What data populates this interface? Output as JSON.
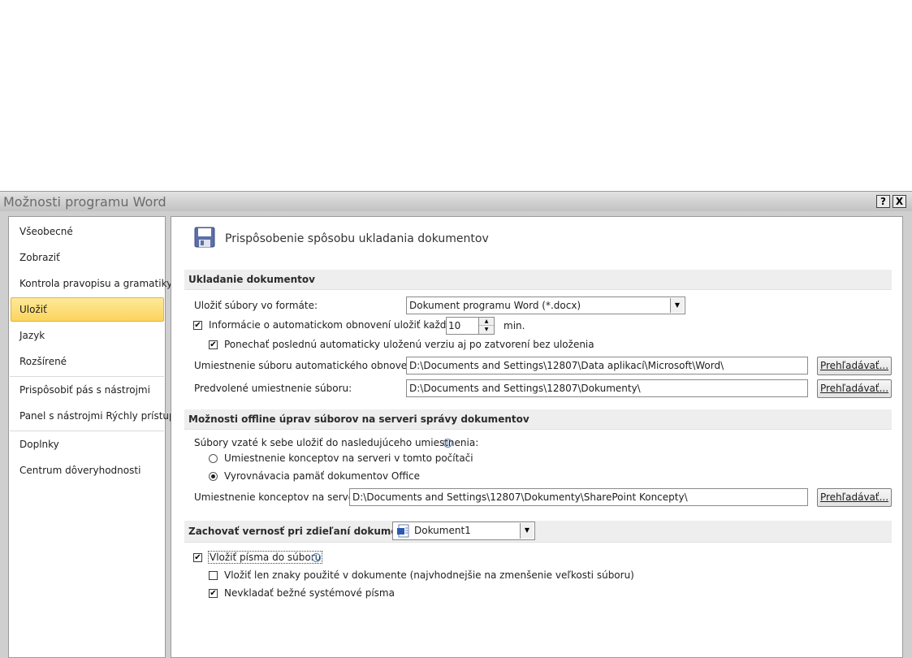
{
  "window": {
    "title": "Možnosti programu Word",
    "help_glyph": "?",
    "close_glyph": "X"
  },
  "sidebar": {
    "items": [
      {
        "label": "Všeobecné"
      },
      {
        "label": "Zobraziť"
      },
      {
        "label": "Kontrola pravopisu a gramatiky"
      },
      {
        "label": "Uložiť",
        "selected": true
      },
      {
        "label": "Jazyk"
      },
      {
        "label": "Rozšírené"
      },
      {
        "label": "Prispôsobiť pás s nástrojmi"
      },
      {
        "label": "Panel s nástrojmi Rýchly prístup"
      },
      {
        "label": "Doplnky"
      },
      {
        "label": "Centrum dôveryhodnosti"
      }
    ]
  },
  "main": {
    "heading": "Prispôsobenie spôsobu ukladania dokumentov",
    "heading_icon": "floppy-disk-icon",
    "save_section": {
      "title": "Ukladanie dokumentov",
      "format_label": "Uložiť súbory vo formáte:",
      "format_value": "Dokument programu Word (*.docx)",
      "autorecover_label": "Informácie o automatickom obnovení uložiť každých",
      "autorecover_checked": true,
      "autorecover_minutes": "10",
      "minutes_unit": "min.",
      "keep_last_label": "Ponechať poslednú automaticky uloženú verziu aj po zatvorení bez uloženia",
      "keep_last_checked": true,
      "autorecover_location_label": "Umiestnenie súboru automatického obnovenia:",
      "autorecover_location_value": "D:\\Documents and Settings\\12807\\Data aplikací\\Microsoft\\Word\\",
      "default_location_label": "Predvolené umiestnenie súboru:",
      "default_location_value": "D:\\Documents and Settings\\12807\\Dokumenty\\",
      "browse_label": "Prehľadávať..."
    },
    "offline_section": {
      "title": "Možnosti offline úprav súborov na serveri správy dokumentov",
      "checkout_label": "Súbory vzaté k sebe uložiť do nasledujúceho umiestnenia:",
      "radio_server_label": "Umiestnenie konceptov na serveri v tomto počítači",
      "radio_server_checked": false,
      "radio_cache_label": "Vyrovnávacia pamäť dokumentov Office",
      "radio_cache_checked": true,
      "drafts_location_label": "Umiestnenie konceptov na serveri:",
      "drafts_location_value": "D:\\Documents and Settings\\12807\\Dokumenty\\SharePoint Koncepty\\",
      "browse_label": "Prehľadávať..."
    },
    "fidelity_section": {
      "title": "Zachovať vernosť pri zdieľaní dokumentu:",
      "document_value": "Dokument1",
      "embed_fonts_label": "Vložiť písma do súboru",
      "embed_fonts_checked": true,
      "embed_used_label": "Vložiť len znaky použité v dokumente (najvhodnejšie na zmenšenie veľkosti súboru)",
      "embed_used_checked": false,
      "no_common_label": "Nevkladať bežné systémové písma",
      "no_common_checked": true
    }
  },
  "glyphs": {
    "check": "✔",
    "dropdown": "▼",
    "spin_up": "▲",
    "spin_down": "▼",
    "info": "i"
  },
  "colors": {
    "selected_bg": "#fcd45c",
    "section_bg": "#eeeeee",
    "dialog_bg": "#cfcfcf"
  }
}
